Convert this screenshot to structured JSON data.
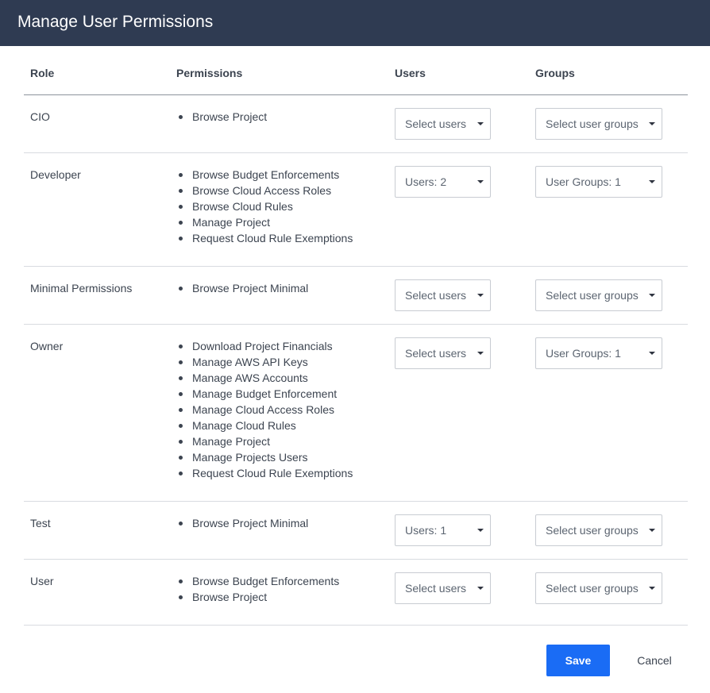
{
  "dialog": {
    "title": "Manage User Permissions"
  },
  "table": {
    "headers": {
      "role": "Role",
      "permissions": "Permissions",
      "users": "Users",
      "groups": "Groups"
    },
    "rows": [
      {
        "role": "CIO",
        "permissions": [
          "Browse Project"
        ],
        "users": "Select users",
        "groups": "Select user groups"
      },
      {
        "role": "Developer",
        "permissions": [
          "Browse Budget Enforcements",
          "Browse Cloud Access Roles",
          "Browse Cloud Rules",
          "Manage Project",
          "Request Cloud Rule Exemptions"
        ],
        "users": "Users: 2",
        "groups": "User Groups: 1"
      },
      {
        "role": "Minimal Permissions",
        "permissions": [
          "Browse Project Minimal"
        ],
        "users": "Select users",
        "groups": "Select user groups"
      },
      {
        "role": "Owner",
        "permissions": [
          "Download Project Financials",
          "Manage AWS API Keys",
          "Manage AWS Accounts",
          "Manage Budget Enforcement",
          "Manage Cloud Access Roles",
          "Manage Cloud Rules",
          "Manage Project",
          "Manage Projects Users",
          "Request Cloud Rule Exemptions"
        ],
        "users": "Select users",
        "groups": "User Groups: 1"
      },
      {
        "role": "Test",
        "permissions": [
          "Browse Project Minimal"
        ],
        "users": "Users: 1",
        "groups": "Select user groups"
      },
      {
        "role": "User",
        "permissions": [
          "Browse Budget Enforcements",
          "Browse Project"
        ],
        "users": "Select users",
        "groups": "Select user groups"
      }
    ]
  },
  "footer": {
    "save_label": "Save",
    "cancel_label": "Cancel"
  },
  "colors": {
    "header_bg": "#2f3b52",
    "primary": "#1a6cf5"
  }
}
